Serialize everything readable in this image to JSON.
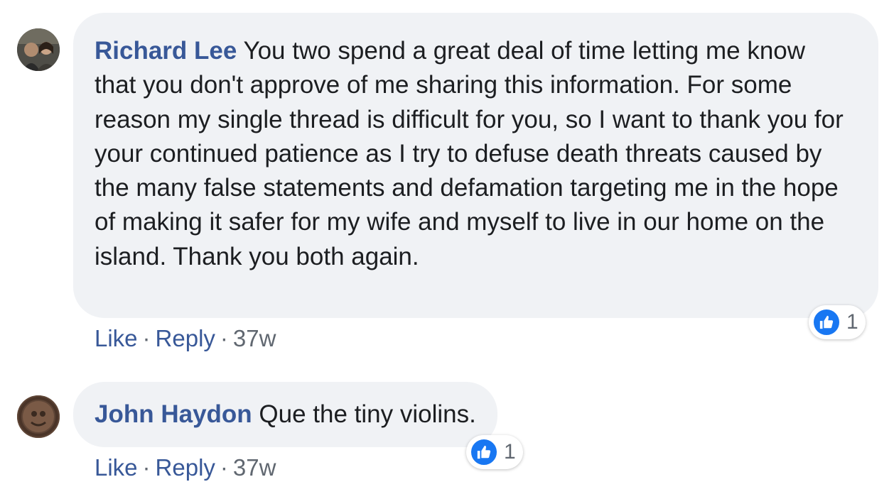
{
  "comments": [
    {
      "author": "Richard Lee",
      "text": "You two spend a great deal of time letting me know that you don't approve of me sharing this information. For some reason my single thread is difficult for you, so I want to thank you for your continued patience as I try to defuse death threats caused by the many false statements and defamation targeting me in the hope of making it safer for my wife and myself to live in our home on the island. Thank you both again.",
      "like_label": "Like",
      "reply_label": "Reply",
      "separator": "·",
      "timestamp": "37w",
      "reaction_count": "1",
      "reaction_icon": "like-thumbs-up-icon"
    },
    {
      "author": "John Haydon",
      "text": "Que the tiny violins.",
      "like_label": "Like",
      "reply_label": "Reply",
      "separator": "·",
      "timestamp": "37w",
      "reaction_count": "1",
      "reaction_icon": "like-thumbs-up-icon"
    }
  ],
  "colors": {
    "author": "#385898",
    "bubble_bg": "#f0f2f5",
    "text": "#1c1e21",
    "meta": "#606770",
    "like_blue": "#1877f2"
  }
}
